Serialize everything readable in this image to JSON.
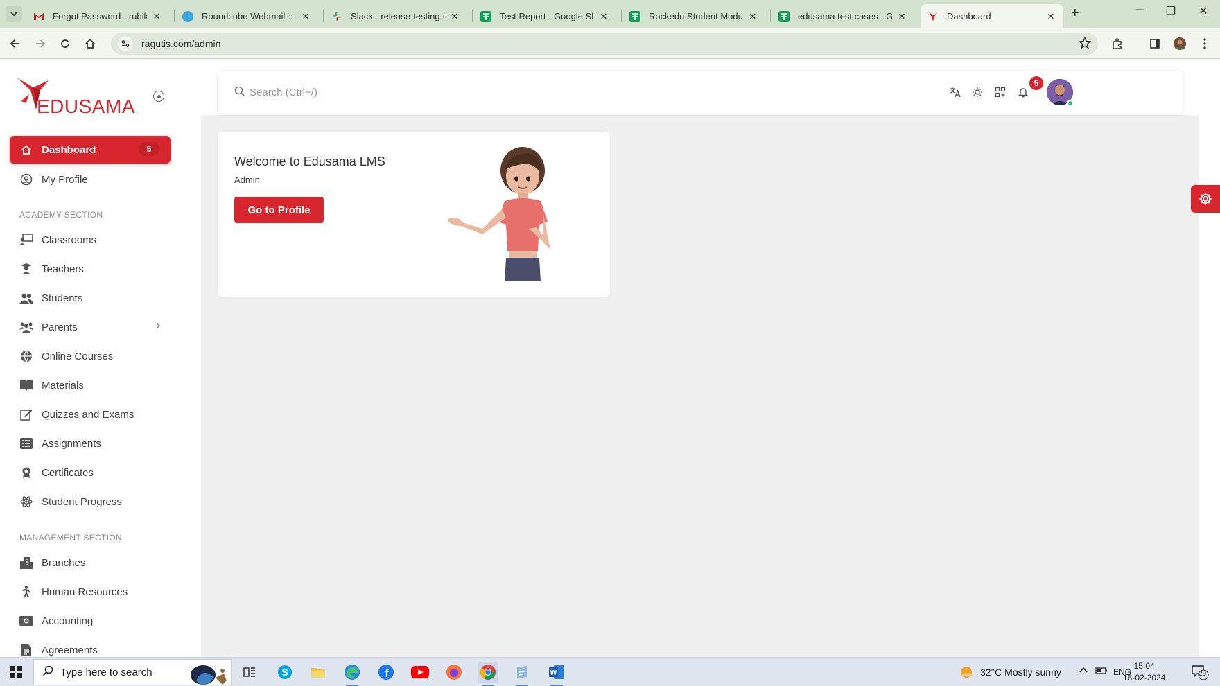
{
  "browser": {
    "tabs": [
      {
        "title": "Forgot Password - rubikaan",
        "favicon": "gmail-icon",
        "color": "#c5221f"
      },
      {
        "title": "Roundcube Webmail :: Forg",
        "favicon": "roundcube-icon",
        "color": "#37a6e0"
      },
      {
        "title": "Slack - release-testing-dev",
        "favicon": "slack-icon",
        "color": "#e01e5a"
      },
      {
        "title": "Test Report - Google Sheet",
        "favicon": "sheets-icon",
        "color": "#0f9d58"
      },
      {
        "title": "Rockedu Student Module -",
        "favicon": "sheets-icon",
        "color": "#0f9d58"
      },
      {
        "title": "edusama test cases - Goog",
        "favicon": "sheets-icon",
        "color": "#0f9d58"
      },
      {
        "title": "Dashboard",
        "favicon": "edusama-icon",
        "color": "#d7262e"
      }
    ],
    "url": "ragutis.com/admin"
  },
  "sidebar": {
    "logo_text": "EDUSAMA",
    "top_items": [
      {
        "label": "Dashboard",
        "icon": "home-icon",
        "badge": "5",
        "active": true
      },
      {
        "label": "My Profile",
        "icon": "user-circle-icon"
      }
    ],
    "academy_label": "ACADEMY SECTION",
    "academy_items": [
      {
        "label": "Classrooms",
        "icon": "classroom-icon"
      },
      {
        "label": "Teachers",
        "icon": "teacher-icon"
      },
      {
        "label": "Students",
        "icon": "students-icon"
      },
      {
        "label": "Parents",
        "icon": "parents-icon",
        "chevron": true
      },
      {
        "label": "Online Courses",
        "icon": "globe-icon"
      },
      {
        "label": "Materials",
        "icon": "book-icon"
      },
      {
        "label": "Quizzes and Exams",
        "icon": "edit-icon"
      },
      {
        "label": "Assignments",
        "icon": "list-icon"
      },
      {
        "label": "Certificates",
        "icon": "award-icon"
      },
      {
        "label": "Student Progress",
        "icon": "atom-icon"
      }
    ],
    "management_label": "MANAGEMENT SECTION",
    "management_items": [
      {
        "label": "Branches",
        "icon": "building-icon"
      },
      {
        "label": "Human Resources",
        "icon": "person-icon"
      },
      {
        "label": "Accounting",
        "icon": "money-icon"
      },
      {
        "label": "Agreements",
        "icon": "document-icon"
      }
    ]
  },
  "topbar": {
    "search_placeholder": "Search (Ctrl+/)",
    "notification_count": "5"
  },
  "welcome": {
    "title": "Welcome to Edusama LMS",
    "role": "Admin",
    "button_label": "Go to Profile"
  },
  "taskbar": {
    "search_placeholder": "Type here to search",
    "weather": "32°C  Mostly sunny",
    "language": "ENG",
    "time": "15:04",
    "date": "16-02-2024",
    "notification_count": "29"
  },
  "colors": {
    "brand": "#d7262e",
    "tabbar": "#d3e3cf",
    "toolbar": "#f2f6ef"
  }
}
